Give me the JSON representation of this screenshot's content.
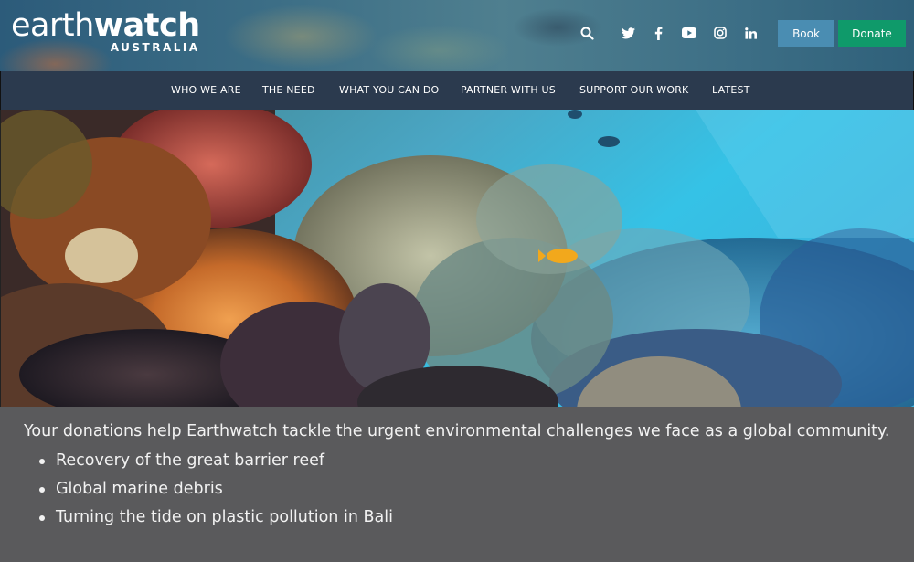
{
  "header": {
    "logo": {
      "main_light": "earth",
      "main_bold": "watch",
      "sub": "AUSTRALIA"
    },
    "icons": [
      "search-icon",
      "twitter-icon",
      "facebook-icon",
      "youtube-icon",
      "instagram-icon",
      "linkedin-icon"
    ],
    "book_label": "Book",
    "donate_label": "Donate",
    "colors": {
      "book": "#4a8db2",
      "donate": "#0f9a6a",
      "nav_bg": "#2b3a4e"
    }
  },
  "nav": {
    "items": [
      {
        "label": "WHO WE ARE"
      },
      {
        "label": "THE NEED"
      },
      {
        "label": "WHAT YOU CAN DO"
      },
      {
        "label": "PARTNER WITH US"
      },
      {
        "label": "SUPPORT OUR WORK"
      },
      {
        "label": "LATEST"
      }
    ]
  },
  "main": {
    "intro": "Your donations help Earthwatch tackle the urgent environmental challenges we face as a global community.",
    "bullets": [
      "Recovery of the great barrier reef",
      "Global marine debris",
      "Turning the tide on plastic pollution in Bali"
    ]
  }
}
